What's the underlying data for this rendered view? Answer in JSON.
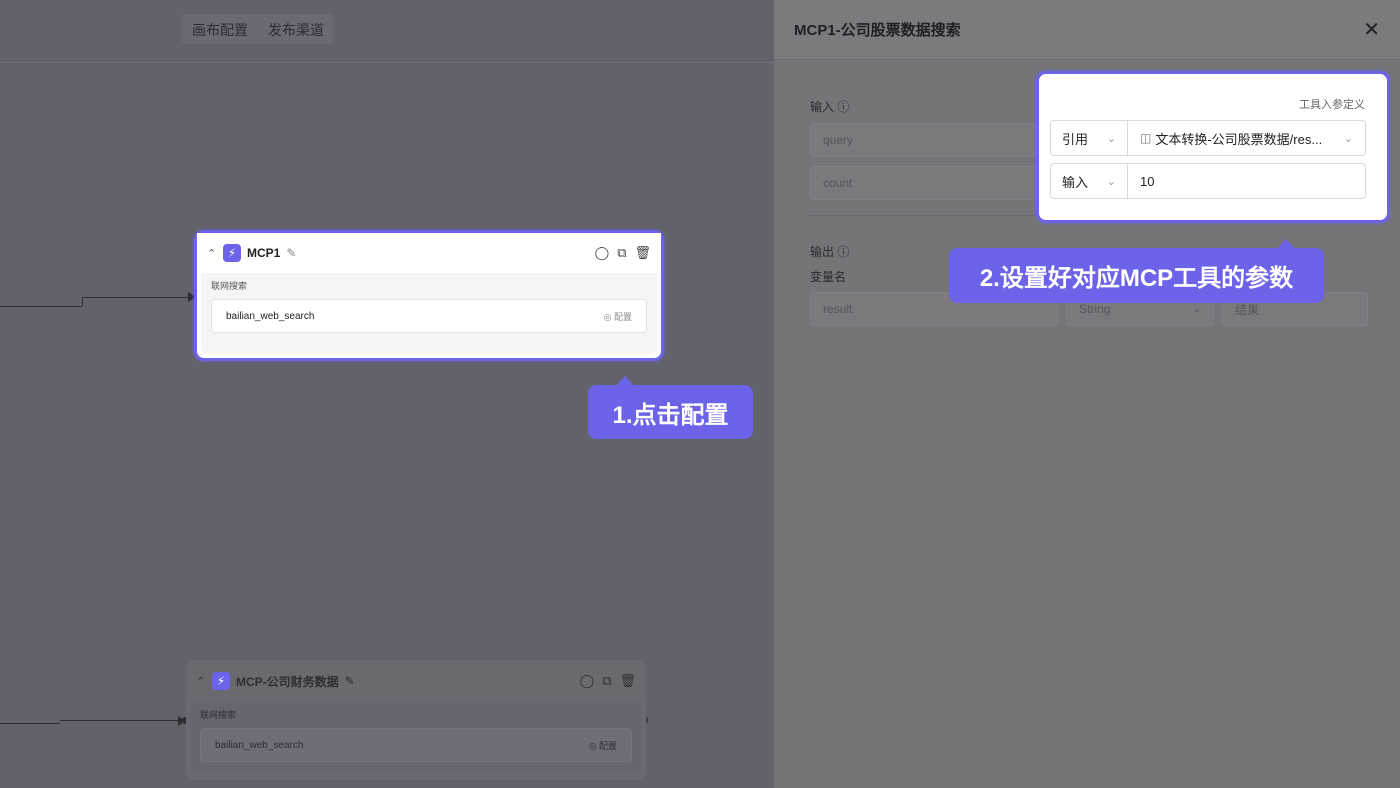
{
  "canvas": {
    "tabs": [
      "画布配置",
      "发布渠道"
    ],
    "node_main": {
      "title": "MCP1",
      "body_label": "联网搜索",
      "tool_name": "bailian_web_search",
      "config_label": "配置"
    },
    "node_second": {
      "title": "MCP-公司财务数据",
      "body_label": "联网搜索",
      "tool_name": "bailian_web_search",
      "config_label": "配置"
    }
  },
  "callouts": {
    "step1": "1.点击配置",
    "step2": "2.设置好对应MCP工具的参数"
  },
  "panel": {
    "title": "MCP1-公司股票数据搜索",
    "input_label": "输入 ⓘ",
    "input_rows": [
      {
        "name_placeholder": "query"
      },
      {
        "name_placeholder": "count"
      }
    ],
    "output_label": "输出 ⓘ",
    "var_name_label": "变量名",
    "output_row": {
      "name": "result",
      "type": "String",
      "desc": "结果"
    },
    "param_caption": "工具入参定义",
    "params": [
      {
        "mode": "引用",
        "value": "文本转换-公司股票数据/res..."
      },
      {
        "mode": "输入",
        "value": "10"
      }
    ]
  },
  "colors": {
    "accent": "#6c63e8"
  }
}
